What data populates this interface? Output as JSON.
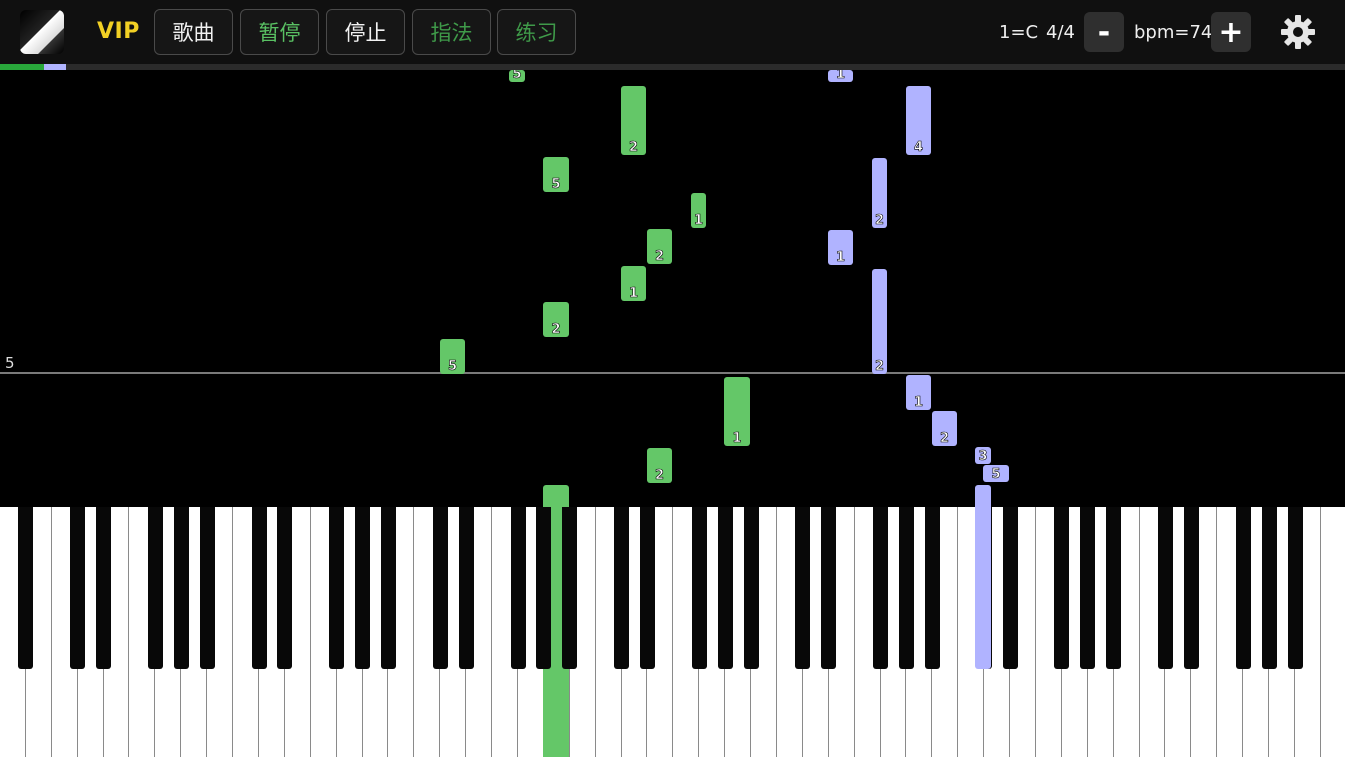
{
  "toolbar": {
    "logo_icon": "piano-app-logo-icon",
    "vip_label": "VIP",
    "buttons": {
      "songs": "歌曲",
      "pause": "暂停",
      "stop": "停止",
      "fingering": "指法",
      "practice": "练习"
    },
    "key_signature": "1=C",
    "time_signature": "4/4",
    "tempo_decrease": "-",
    "tempo_label": "bpm=74",
    "tempo_increase": "+",
    "settings_icon": "gear-icon"
  },
  "playback": {
    "played_fraction": 0.049
  },
  "roll": {
    "measure_number": "5",
    "notes": {
      "g1": "5",
      "g2": "2",
      "g3": "5",
      "g4": "1",
      "g5": "2",
      "g6": "1",
      "g7": "2",
      "g8": "5",
      "g9": "1",
      "g10": "2",
      "b1": "1",
      "b2": "4",
      "b3": "2",
      "b4": "1",
      "b5": "2",
      "b6": "1",
      "b7": "2",
      "b8": "3",
      "b9": "5"
    }
  },
  "colors": {
    "right_hand": "#64c768",
    "left_hand": "#b0b3ff",
    "vip": "#f2d024",
    "background": "#000000"
  }
}
